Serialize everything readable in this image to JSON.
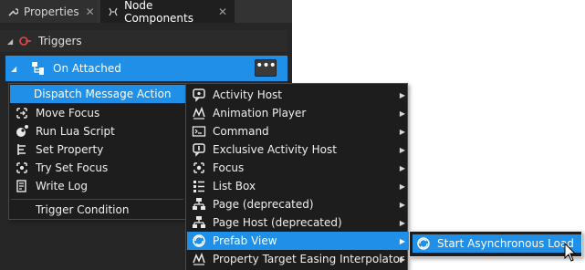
{
  "tabs": [
    {
      "label": "Properties",
      "icon": "wrench-icon",
      "close": "✕"
    },
    {
      "label": "Node Components",
      "icon": "node-components-icon",
      "close": "✕"
    }
  ],
  "tree": {
    "triggers": {
      "label": "Triggers",
      "expander": "◢",
      "icon": "trigger-icon"
    },
    "on_attached": {
      "label": "On Attached",
      "expander": "◢",
      "icon": "node-trigger-icon",
      "more": "•••"
    }
  },
  "main_menu": {
    "items": [
      {
        "label": "Dispatch Message Action",
        "icon": "",
        "has_submenu": true
      },
      {
        "label": "Move Focus",
        "icon": "move-focus-icon"
      },
      {
        "label": "Run Lua Script",
        "icon": "lua-script-icon"
      },
      {
        "label": "Set Property",
        "icon": "set-property-icon"
      },
      {
        "label": "Try Set Focus",
        "icon": "try-set-focus-icon"
      },
      {
        "label": "Write Log",
        "icon": "write-log-icon"
      },
      {
        "label": "Trigger Condition",
        "icon": ""
      }
    ]
  },
  "sub_menu": {
    "items": [
      {
        "label": "Activity Host",
        "icon": "activity-host-icon"
      },
      {
        "label": "Animation Player",
        "icon": "animation-player-icon"
      },
      {
        "label": "Command",
        "icon": "command-icon"
      },
      {
        "label": "Exclusive Activity Host",
        "icon": "exclusive-activity-host-icon"
      },
      {
        "label": "Focus",
        "icon": "focus-icon"
      },
      {
        "label": "List Box",
        "icon": "list-box-icon"
      },
      {
        "label": "Page (deprecated)",
        "icon": "page-icon"
      },
      {
        "label": "Page Host (deprecated)",
        "icon": "page-host-icon"
      },
      {
        "label": "Prefab View",
        "icon": "prefab-view-icon"
      },
      {
        "label": "Property Target Easing Interpolator",
        "icon": "interpolator-icon"
      }
    ]
  },
  "sub_sub_menu": {
    "items": [
      {
        "label": "Start Asynchronous Load",
        "icon": "prefab-view-icon"
      }
    ]
  },
  "arrow": "▶",
  "colors": {
    "accent": "#1f8fe8",
    "panel": "#262626",
    "menu": "#1d1d1d"
  }
}
